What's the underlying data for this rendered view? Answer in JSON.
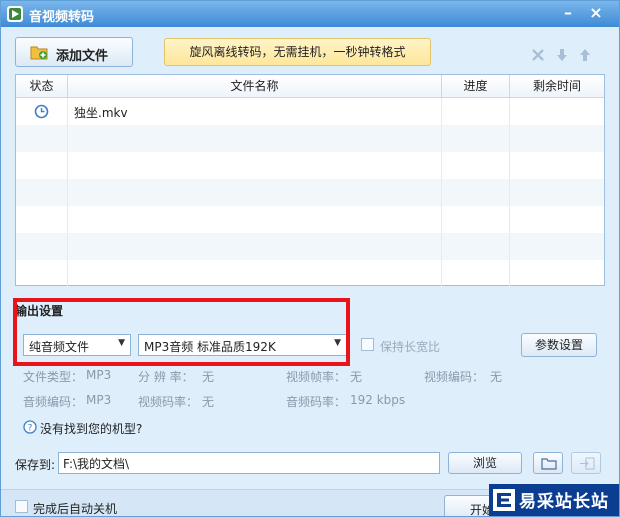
{
  "window": {
    "title": "音视频转码"
  },
  "toolbar": {
    "add_file_label": "添加文件",
    "promo_text": "旋风离线转码，无需挂机，一秒钟转格式"
  },
  "table": {
    "headers": [
      "状态",
      "文件名称",
      "进度",
      "剩余时间"
    ],
    "rows": [
      {
        "status_icon": "clock-icon",
        "name": "独坐.mkv",
        "progress": "",
        "remaining": ""
      }
    ]
  },
  "output": {
    "section_title": "输出设置",
    "format_select": "纯音频文件",
    "preset_select": "MP3音频 标准品质192K",
    "keep_ratio_label": "保持长宽比",
    "params_button": "参数设置",
    "info": {
      "file_type_label": "文件类型：",
      "file_type": "MP3",
      "resolution_label": "分 辨 率：",
      "resolution": "无",
      "video_fps_label": "视频帧率：",
      "video_fps": "无",
      "video_codec_label": "视频编码：",
      "video_codec": "无",
      "audio_codec_label": "音频编码：",
      "audio_codec": "MP3",
      "video_bitrate_label": "视频码率：",
      "video_bitrate": "无",
      "audio_bitrate_label": "音频码率：",
      "audio_bitrate": "192 kbps"
    },
    "help_text": "没有找到您的机型?"
  },
  "save": {
    "label": "保存到:",
    "path": "F:\\我的文档\\",
    "browse_button": "浏览"
  },
  "bottom": {
    "auto_shutdown_label": "完成后自动关机",
    "start_button": "开始"
  },
  "watermark": {
    "text": "易采站长站"
  }
}
